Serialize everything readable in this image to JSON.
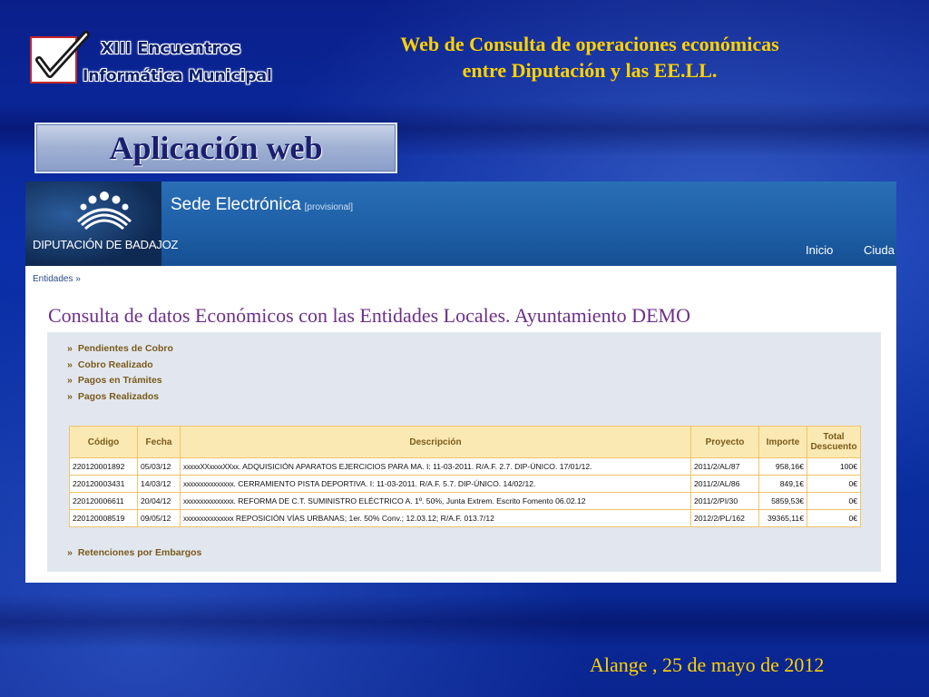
{
  "logo": {
    "line1": "XIII Encuentros",
    "line2": "Informática Municipal"
  },
  "slide_title": {
    "line1": "Web  de Consulta de operaciones económicas",
    "line2": "entre Diputación y las EE.LL."
  },
  "section_label": "Aplicación web",
  "sede": {
    "title": "Sede Electrónica",
    "provisional": "[provisional]",
    "org": "DIPUTACIÓN DE BADAJOZ",
    "nav": [
      "Inicio",
      "Ciuda"
    ]
  },
  "breadcrumb": "Entidades »",
  "page_title": "Consulta de datos Económicos con las Entidades Locales. Ayuntamiento DEMO",
  "menu": [
    {
      "label": "Pendientes de Cobro"
    },
    {
      "label": "Cobro Realizado"
    },
    {
      "label": "Pagos en Trámites"
    },
    {
      "label": "Pagos Realizados"
    }
  ],
  "menu_marker": "»",
  "retenciones": "Retenciones por Embargos",
  "table": {
    "headers": [
      "Código",
      "Fecha",
      "Descripción",
      "Proyecto",
      "Importe",
      "Total Descuento"
    ],
    "rows": [
      {
        "codigo": "220120001892",
        "fecha": "05/03/12",
        "mask": "xxxxxXXxxxxXXxx",
        "desc": ". ADQUISICIÓN APARATOS EJERCICIOS PARA MA. I: 11-03-2011. R/A.F. 2.7. DIP-ÚNICO. 17/01/12.",
        "proyecto": "2011/2/AL/87",
        "importe": "958,16€",
        "descuento": "100€"
      },
      {
        "codigo": "220120003431",
        "fecha": "14/03/12",
        "mask": "xxxxxxxxxxxxxxx",
        "desc": ". CERRAMIENTO PISTA DEPORTIVA. I: 11-03-2011. R/A.F. 5.7. DIP-ÚNICO. 14/02/12.",
        "proyecto": "2011/2/AL/86",
        "importe": "849,1€",
        "descuento": "0€"
      },
      {
        "codigo": "220120006611",
        "fecha": "20/04/12",
        "mask": "xxxxxxxxxxxxxxx",
        "desc": ". REFORMA DE C.T. SUMINISTRO ELÉCTRICO A. 1º. 50%, Junta Extrem. Escrito Fomento 06.02.12",
        "proyecto": "2011/2/PI/30",
        "importe": "5859,53€",
        "descuento": "0€"
      },
      {
        "codigo": "220120008519",
        "fecha": "09/05/12",
        "mask": "xxxxxxxxxxxxxxx",
        "desc": " REPOSICIÓN VÍAS URBANAS; 1er. 50% Conv.; 12.03.12; R/A.F. 013.7/12",
        "proyecto": "2012/2/PL/162",
        "importe": "39365,11€",
        "descuento": "0€"
      }
    ]
  },
  "footer_date": "Alange , 25 de mayo de 2012",
  "colors": {
    "title_yellow": "#ffd200",
    "background_blue": "#0b2fa8",
    "menu_brown": "#7a5a1a",
    "page_title_purple": "#6d2f8a",
    "table_header": "#fbe9b3"
  }
}
